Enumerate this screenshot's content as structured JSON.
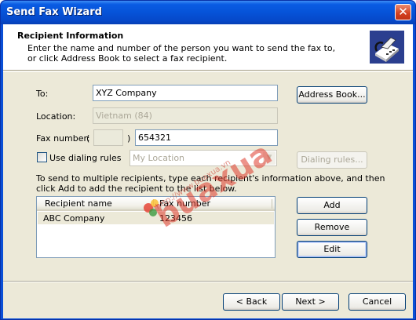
{
  "window": {
    "title": "Send Fax Wizard",
    "close_glyph": "✕"
  },
  "header": {
    "title": "Recipient Information",
    "desc_line1": "Enter the name and number of the person you want to send the fax to,",
    "desc_line2": "or click Address Book to select a fax recipient.",
    "icon": "fax-machine-icon"
  },
  "form": {
    "to_label": "To:",
    "to_value": "XYZ Company",
    "address_book_button": "Address Book...",
    "location_label": "Location:",
    "location_value": "Vietnam (84)",
    "fax_number_label": "Fax number:",
    "paren_open": "(",
    "paren_close": ")",
    "area_code_value": "",
    "fax_number_value": "654321",
    "use_dialing_rules_label": "Use dialing rules",
    "use_dialing_rules_checked": false,
    "dialing_location_value": "My Location",
    "dialing_rules_button": "Dialing rules...",
    "instructions_line1": "To send to multiple recipients, type each recipient's information above, and then",
    "instructions_line2": "click Add to add the recipient to the list below."
  },
  "recipients": {
    "columns": [
      "Recipient name",
      "Fax number"
    ],
    "rows": [
      {
        "name": "ABC Company",
        "fax": "123456"
      }
    ]
  },
  "list_buttons": {
    "add": "Add",
    "remove": "Remove",
    "edit": "Edit"
  },
  "footer": {
    "back": "< Back",
    "next": "Next >",
    "cancel": "Cancel"
  },
  "watermark": {
    "text": "buaxua",
    "url": "http://www.buaxua.vn"
  },
  "colors": {
    "titlebar": "#0653d8",
    "dialog_face": "#ece9d8",
    "button_border": "#003c74",
    "field_border": "#7f9db9",
    "disabled_text": "#aca899"
  }
}
